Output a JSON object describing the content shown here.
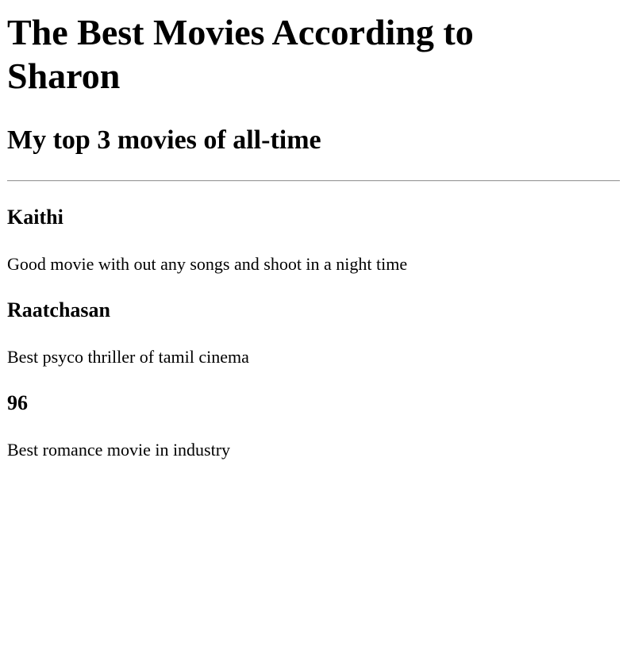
{
  "page": {
    "title": "The Best Movies According to Sharon",
    "subtitle": "My top 3 movies of all-time"
  },
  "movies": [
    {
      "title": "Kaithi",
      "description": "Good movie with out any songs and shoot in a night time"
    },
    {
      "title": "Raatchasan",
      "description": "Best psyco thriller of tamil cinema"
    },
    {
      "title": "96",
      "description": "Best romance movie in industry"
    }
  ]
}
